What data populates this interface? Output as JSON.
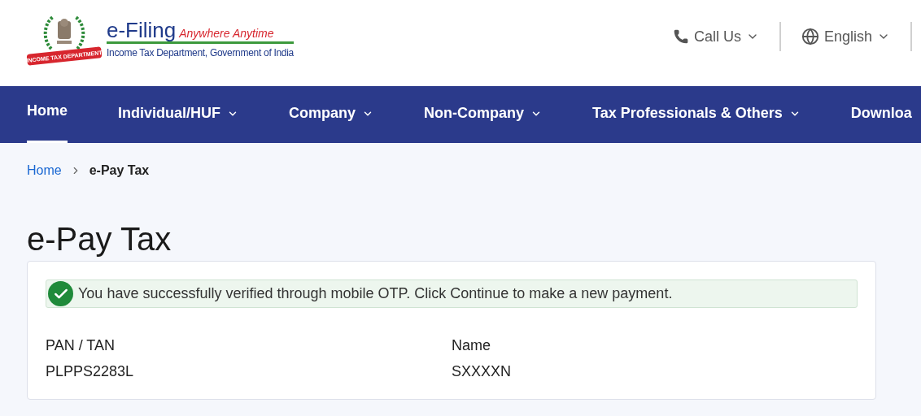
{
  "logo": {
    "ribbon": "INCOME TAX DEPARTMENT",
    "title": "e-Filing",
    "tagline": "Anywhere Anytime",
    "subtitle": "Income Tax Department, Government of India"
  },
  "header_actions": [
    {
      "kind": "phone",
      "label": "Call Us"
    },
    {
      "kind": "language",
      "label": "English"
    }
  ],
  "nav": [
    {
      "label": "Home",
      "selected": true,
      "dropdown": false
    },
    {
      "label": "Individual/HUF",
      "selected": false,
      "dropdown": true
    },
    {
      "label": "Company",
      "selected": false,
      "dropdown": true
    },
    {
      "label": "Non-Company",
      "selected": false,
      "dropdown": true
    },
    {
      "label": "Tax Professionals & Others",
      "selected": false,
      "dropdown": true
    },
    {
      "label": "Downloa",
      "selected": false,
      "dropdown": false
    }
  ],
  "breadcrumb": [
    "Home",
    "e-Pay Tax"
  ],
  "page_title": "e-Pay Tax",
  "alert": "You have successfully verified through mobile OTP. Click Continue to make a new payment.",
  "fields": [
    {
      "label": "PAN / TAN",
      "value": "PLPPS2283L"
    },
    {
      "label": "Name",
      "value": "SXXXXN"
    }
  ]
}
